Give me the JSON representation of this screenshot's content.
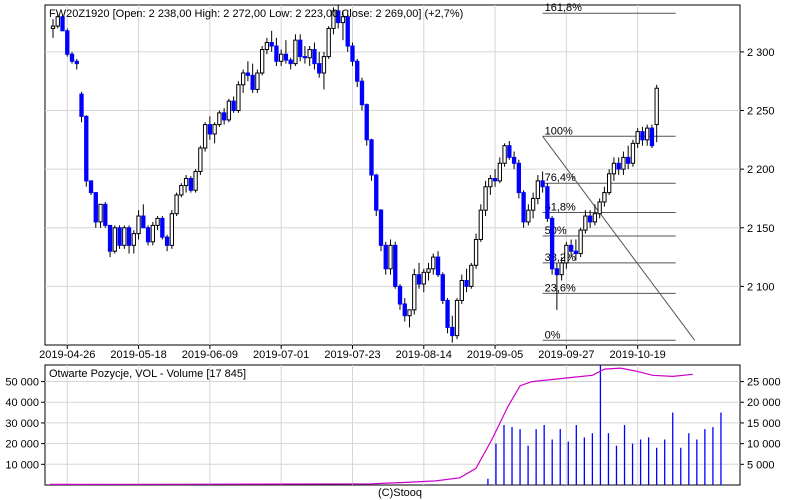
{
  "chart_data": [
    {
      "type": "candlestick",
      "title": "FW20Z1920 [Open: 2 238,00  High: 2 272,00  Low: 2 223,00  Close: 2 269,00] (+2,7%)",
      "ylim": [
        2050,
        2340
      ],
      "yticks": [
        2100,
        2150,
        2200,
        2250,
        2300
      ],
      "ytick_labels": [
        "2 100",
        "2 150",
        "2 200",
        "2 250",
        "2 300"
      ],
      "xticks": [
        3,
        18,
        33,
        48,
        63,
        78,
        93,
        108,
        123
      ],
      "xtick_labels": [
        "2019-04-26",
        "2019-05-18",
        "2019-06-09",
        "2019-07-01",
        "2019-07-23",
        "2019-08-14",
        "2019-09-05",
        "2019-09-27",
        "2019-10-19"
      ],
      "x_range": [
        0,
        142
      ],
      "grid": true,
      "up_color": "#ffffff",
      "down_color": "#0000ff",
      "candles": [
        [
          2320,
          2328,
          2312,
          2322
        ],
        [
          2322,
          2332,
          2320,
          2330
        ],
        [
          2330,
          2332,
          2318,
          2318
        ],
        [
          2318,
          2320,
          2296,
          2298
        ],
        [
          2298,
          2300,
          2290,
          2292
        ],
        [
          2292,
          2294,
          2285,
          2290
        ],
        [
          2264,
          2266,
          2240,
          2245
        ],
        [
          2245,
          2246,
          2185,
          2190
        ],
        [
          2190,
          2190,
          2178,
          2180
        ],
        [
          2180,
          2180,
          2150,
          2155
        ],
        [
          2155,
          2170,
          2150,
          2170
        ],
        [
          2170,
          2172,
          2150,
          2152
        ],
        [
          2152,
          2152,
          2125,
          2130
        ],
        [
          2130,
          2152,
          2128,
          2150
        ],
        [
          2150,
          2152,
          2132,
          2135
        ],
        [
          2135,
          2152,
          2132,
          2150
        ],
        [
          2150,
          2152,
          2128,
          2135
        ],
        [
          2135,
          2148,
          2128,
          2145
        ],
        [
          2145,
          2165,
          2140,
          2160
        ],
        [
          2160,
          2170,
          2150,
          2150
        ],
        [
          2150,
          2152,
          2135,
          2138
        ],
        [
          2138,
          2155,
          2135,
          2152
        ],
        [
          2152,
          2160,
          2148,
          2158
        ],
        [
          2158,
          2160,
          2140,
          2142
        ],
        [
          2142,
          2144,
          2130,
          2135
        ],
        [
          2135,
          2165,
          2132,
          2162
        ],
        [
          2162,
          2180,
          2160,
          2178
        ],
        [
          2178,
          2188,
          2176,
          2186
        ],
        [
          2186,
          2195,
          2180,
          2192
        ],
        [
          2192,
          2194,
          2180,
          2182
        ],
        [
          2182,
          2200,
          2180,
          2198
        ],
        [
          2198,
          2220,
          2195,
          2218
        ],
        [
          2218,
          2240,
          2215,
          2238
        ],
        [
          2238,
          2245,
          2225,
          2230
        ],
        [
          2230,
          2240,
          2222,
          2238
        ],
        [
          2238,
          2250,
          2236,
          2248
        ],
        [
          2248,
          2252,
          2238,
          2242
        ],
        [
          2242,
          2260,
          2240,
          2258
        ],
        [
          2258,
          2262,
          2248,
          2250
        ],
        [
          2250,
          2275,
          2248,
          2272
        ],
        [
          2272,
          2285,
          2265,
          2282
        ],
        [
          2282,
          2292,
          2275,
          2280
        ],
        [
          2280,
          2290,
          2265,
          2268
        ],
        [
          2268,
          2285,
          2265,
          2282
        ],
        [
          2282,
          2305,
          2280,
          2302
        ],
        [
          2302,
          2312,
          2298,
          2308
        ],
        [
          2308,
          2318,
          2300,
          2305
        ],
        [
          2305,
          2312,
          2288,
          2292
        ],
        [
          2292,
          2302,
          2288,
          2298
        ],
        [
          2298,
          2310,
          2290,
          2293
        ],
        [
          2293,
          2295,
          2285,
          2290
        ],
        [
          2290,
          2315,
          2288,
          2310
        ],
        [
          2310,
          2315,
          2292,
          2296
        ],
        [
          2296,
          2305,
          2290,
          2295
        ],
        [
          2295,
          2305,
          2288,
          2302
        ],
        [
          2302,
          2308,
          2285,
          2290
        ],
        [
          2290,
          2300,
          2278,
          2282
        ],
        [
          2282,
          2300,
          2268,
          2296
        ],
        [
          2296,
          2322,
          2294,
          2320
        ],
        [
          2320,
          2338,
          2315,
          2335
        ],
        [
          2335,
          2340,
          2320,
          2325
        ],
        [
          2325,
          2335,
          2310,
          2330
        ],
        [
          2330,
          2335,
          2300,
          2305
        ],
        [
          2305,
          2308,
          2288,
          2292
        ],
        [
          2292,
          2294,
          2270,
          2275
        ],
        [
          2275,
          2278,
          2250,
          2255
        ],
        [
          2255,
          2256,
          2220,
          2225
        ],
        [
          2225,
          2226,
          2190,
          2195
        ],
        [
          2195,
          2196,
          2160,
          2165
        ],
        [
          2165,
          2166,
          2130,
          2135
        ],
        [
          2135,
          2138,
          2110,
          2115
        ],
        [
          2115,
          2140,
          2110,
          2135
        ],
        [
          2135,
          2138,
          2098,
          2100
        ],
        [
          2100,
          2102,
          2080,
          2085
        ],
        [
          2085,
          2090,
          2070,
          2075
        ],
        [
          2075,
          2080,
          2065,
          2080
        ],
        [
          2080,
          2115,
          2076,
          2110
        ],
        [
          2110,
          2120,
          2098,
          2102
        ],
        [
          2102,
          2115,
          2095,
          2112
        ],
        [
          2112,
          2120,
          2105,
          2115
        ],
        [
          2115,
          2128,
          2110,
          2125
        ],
        [
          2125,
          2130,
          2108,
          2110
        ],
        [
          2110,
          2112,
          2085,
          2088
        ],
        [
          2088,
          2090,
          2060,
          2065
        ],
        [
          2065,
          2075,
          2052,
          2058
        ],
        [
          2058,
          2090,
          2055,
          2088
        ],
        [
          2088,
          2110,
          2085,
          2105
        ],
        [
          2105,
          2115,
          2095,
          2100
        ],
        [
          2100,
          2120,
          2098,
          2118
        ],
        [
          2118,
          2145,
          2115,
          2140
        ],
        [
          2140,
          2170,
          2138,
          2165
        ],
        [
          2165,
          2190,
          2160,
          2185
        ],
        [
          2185,
          2195,
          2178,
          2192
        ],
        [
          2192,
          2200,
          2185,
          2190
        ],
        [
          2190,
          2210,
          2188,
          2205
        ],
        [
          2205,
          2222,
          2202,
          2220
        ],
        [
          2220,
          2224,
          2208,
          2210
        ],
        [
          2210,
          2215,
          2200,
          2205
        ],
        [
          2205,
          2208,
          2175,
          2180
        ],
        [
          2180,
          2182,
          2150,
          2155
        ],
        [
          2155,
          2170,
          2152,
          2165
        ],
        [
          2165,
          2180,
          2158,
          2175
        ],
        [
          2175,
          2195,
          2170,
          2190
        ],
        [
          2190,
          2198,
          2180,
          2185
        ],
        [
          2185,
          2188,
          2155,
          2158
        ],
        [
          2158,
          2160,
          2110,
          2115
        ],
        [
          2115,
          2120,
          2080,
          2110
        ],
        [
          2110,
          2125,
          2105,
          2120
        ],
        [
          2120,
          2138,
          2115,
          2135
        ],
        [
          2135,
          2140,
          2125,
          2130
        ],
        [
          2130,
          2140,
          2122,
          2128
        ],
        [
          2128,
          2150,
          2125,
          2148
        ],
        [
          2148,
          2165,
          2145,
          2160
        ],
        [
          2160,
          2165,
          2150,
          2155
        ],
        [
          2155,
          2170,
          2152,
          2162
        ],
        [
          2162,
          2175,
          2158,
          2172
        ],
        [
          2172,
          2185,
          2168,
          2180
        ],
        [
          2180,
          2200,
          2178,
          2196
        ],
        [
          2196,
          2210,
          2190,
          2205
        ],
        [
          2205,
          2210,
          2195,
          2200
        ],
        [
          2200,
          2215,
          2195,
          2210
        ],
        [
          2210,
          2220,
          2200,
          2205
        ],
        [
          2205,
          2225,
          2202,
          2222
        ],
        [
          2222,
          2235,
          2218,
          2232
        ],
        [
          2232,
          2236,
          2220,
          2225
        ],
        [
          2225,
          2238,
          2220,
          2235
        ],
        [
          2235,
          2238,
          2218,
          2220
        ],
        [
          2238,
          2272,
          2223,
          2269
        ]
      ],
      "fib": {
        "x_start": 103,
        "x_end": 131,
        "levels": [
          {
            "label": "161,8%",
            "value": 2333
          },
          {
            "label": "100%",
            "value": 2228
          },
          {
            "label": "76,4%",
            "value": 2188
          },
          {
            "label": "61,8%",
            "value": 2163
          },
          {
            "label": "50%",
            "value": 2143
          },
          {
            "label": "38,2%",
            "value": 2120
          },
          {
            "label": "23,6%",
            "value": 2094
          },
          {
            "label": "0%",
            "value": 2054
          }
        ],
        "trend_from": [
          103,
          2228
        ],
        "trend_to": [
          135,
          2054
        ]
      }
    },
    {
      "type": "line_bar",
      "title": "Otwarte Pozycje, VOL - Volume [17 845]",
      "left_ylim": [
        0,
        58000
      ],
      "left_yticks": [
        10000,
        20000,
        30000,
        40000,
        50000
      ],
      "left_ytick_labels": [
        "10 000",
        "20 000",
        "30 000",
        "40 000",
        "50 000"
      ],
      "right_ylim": [
        0,
        29000
      ],
      "right_yticks": [
        5000,
        10000,
        15000,
        20000,
        25000
      ],
      "right_ytick_labels": [
        "5 000",
        "10 000",
        "15 000",
        "20 000",
        "25 000"
      ],
      "open_interest": [
        [
          0,
          300
        ],
        [
          40,
          400
        ],
        [
          80,
          600
        ],
        [
          88,
          1200
        ],
        [
          96,
          2000
        ],
        [
          102,
          3500
        ],
        [
          106,
          8000
        ],
        [
          110,
          22000
        ],
        [
          114,
          38000
        ],
        [
          117,
          48000
        ],
        [
          120,
          50000
        ],
        [
          125,
          51000
        ],
        [
          130,
          52000
        ],
        [
          135,
          53000
        ],
        [
          138,
          56000
        ],
        [
          142,
          56500
        ],
        [
          146,
          55000
        ],
        [
          150,
          53000
        ],
        [
          155,
          52500
        ],
        [
          160,
          53500
        ]
      ],
      "volume": [
        [
          109,
          1500
        ],
        [
          111,
          10000
        ],
        [
          113,
          14500
        ],
        [
          115,
          14000
        ],
        [
          117,
          13500
        ],
        [
          119,
          9500
        ],
        [
          121,
          13500
        ],
        [
          123,
          14500
        ],
        [
          125,
          11000
        ],
        [
          127,
          13500
        ],
        [
          129,
          10500
        ],
        [
          131,
          14500
        ],
        [
          133,
          11500
        ],
        [
          135,
          12500
        ],
        [
          137,
          29000
        ],
        [
          139,
          12500
        ],
        [
          141,
          9500
        ],
        [
          143,
          14500
        ],
        [
          145,
          10000
        ],
        [
          147,
          11000
        ],
        [
          149,
          11500
        ],
        [
          151,
          9000
        ],
        [
          153,
          11000
        ],
        [
          155,
          17500
        ],
        [
          157,
          9000
        ],
        [
          159,
          12500
        ],
        [
          161,
          11000
        ],
        [
          163,
          13500
        ],
        [
          165,
          14000
        ],
        [
          167,
          17500
        ]
      ],
      "x_range": [
        0,
        170
      ],
      "line_color": "#cc00cc",
      "bar_color": "#0000ff",
      "grid": true
    }
  ],
  "footer": "(C)Stooq"
}
